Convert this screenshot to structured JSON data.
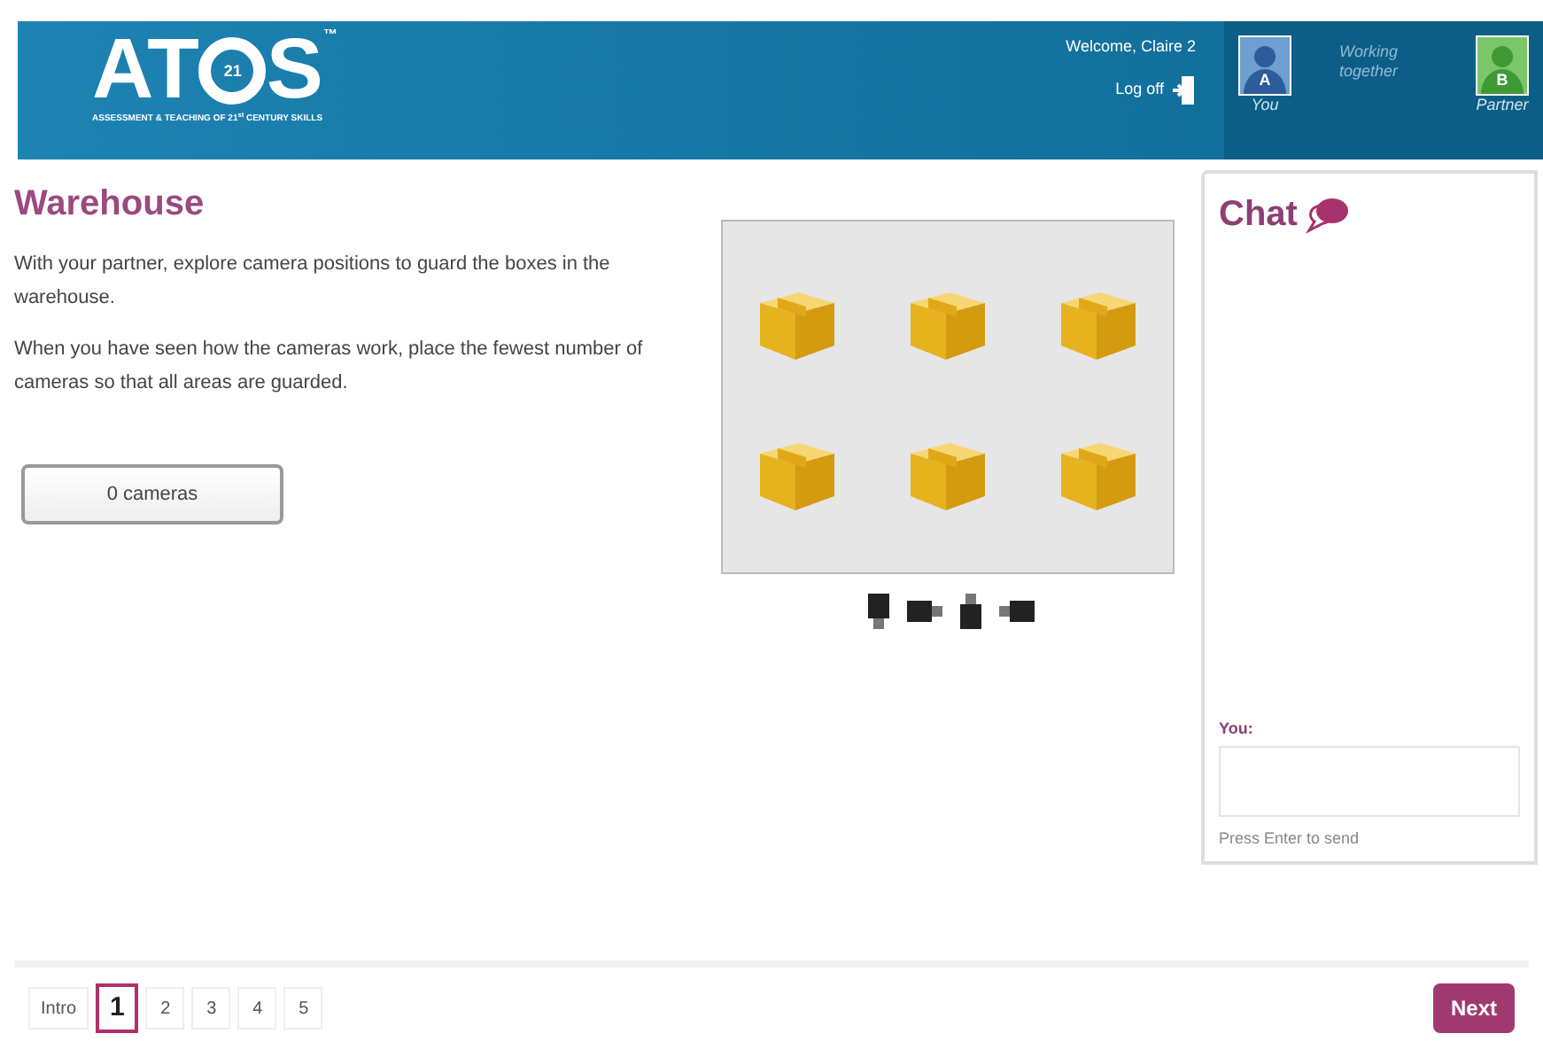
{
  "header": {
    "logo": {
      "before": "AT",
      "badge": "21",
      "after": "S",
      "tm": "™",
      "tagline": "ASSESSMENT & TEACHING OF 21$^{st}$ CENTURY SKILLS"
    },
    "welcome": "Welcome, Claire 2",
    "logoff": "Log off",
    "you": {
      "letter": "A",
      "label": "You"
    },
    "together": "Working together",
    "partner": {
      "letter": "B",
      "label": "Partner"
    }
  },
  "task": {
    "title": "Warehouse",
    "paragraphs": [
      "With your partner, explore camera positions to guard the boxes in the warehouse.",
      "When you have seen how the cameras work, place the fewest number of cameras so that all areas are guarded."
    ],
    "counter": "0 cameras"
  },
  "chat": {
    "title": "Chat",
    "you_label": "You:",
    "hint": "Press Enter to send"
  },
  "pages": [
    {
      "label": "Intro",
      "selected": false
    },
    {
      "label": "1",
      "selected": true
    },
    {
      "label": "2",
      "selected": false
    },
    {
      "label": "3",
      "selected": false
    },
    {
      "label": "4",
      "selected": false
    },
    {
      "label": "5",
      "selected": false
    }
  ],
  "next": "Next"
}
